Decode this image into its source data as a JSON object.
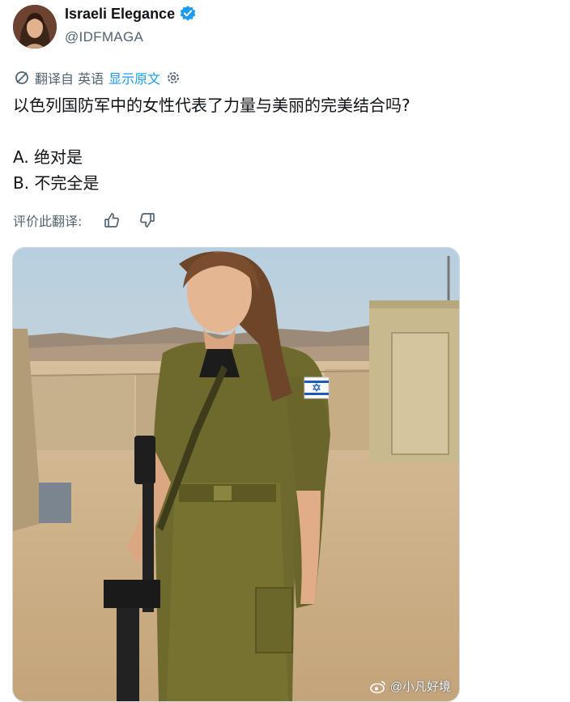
{
  "author": {
    "display_name": "Israeli Elegance",
    "handle": "@IDFMAGA",
    "verified_icon": "verified-badge-icon",
    "avatar_icon": "avatar-photo"
  },
  "translation": {
    "icon": "translate-icon",
    "label": "翻译自 英语",
    "show_original": "显示原文",
    "settings_icon": "gear-icon"
  },
  "tweet": {
    "question": "以色列国防军中的女性代表了力量与美丽的完美结合吗?",
    "option_a": "A. 绝对是",
    "option_b": "B. 不完全是"
  },
  "rate": {
    "label": "评价此翻译:",
    "thumbs_up_icon": "thumbs-up-icon",
    "thumbs_down_icon": "thumbs-down-icon"
  },
  "media": {
    "description_icon": "photo-soldier-desert"
  },
  "watermark": {
    "text": "@小凡好境",
    "icon": "weibo-icon"
  },
  "colors": {
    "accent": "#1d9bf0",
    "secondary_text": "#536471",
    "primary_text": "#0f1419"
  }
}
